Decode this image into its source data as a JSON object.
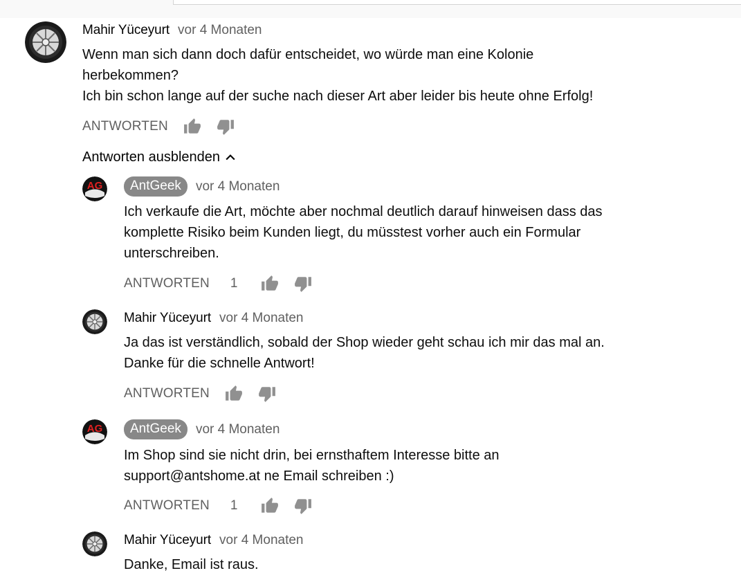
{
  "toggle_replies_label": "Antworten ausblenden",
  "reply_button_label": "ANTWORTEN",
  "comments": [
    {
      "author": "Mahir Yüceyurt",
      "time": "vor 4 Monaten",
      "text": "Wenn man sich dann doch dafür entscheidet, wo würde man eine Kolonie\nherbekommen?\nIch bin schon lange auf der suche nach dieser Art aber leider bis heute ohne Erfolg!",
      "likes": ""
    },
    {
      "author": "AntGeek",
      "time": "vor 4 Monaten",
      "text": "Ich verkaufe die Art, möchte aber nochmal deutlich darauf hinweisen dass das\nkomplette Risiko beim Kunden liegt, du müsstest vorher auch ein Formular\nunterschreiben.",
      "likes": "1"
    },
    {
      "author": "Mahir Yüceyurt",
      "time": "vor 4 Monaten",
      "text": "Ja das ist verständlich, sobald der Shop wieder geht schau ich mir das mal an.\nDanke für die schnelle Antwort!",
      "likes": ""
    },
    {
      "author": "AntGeek",
      "time": "vor 4 Monaten",
      "text": "Im Shop sind sie nicht drin, bei ernsthaftem Interesse bitte an\nsupport@antshome.at ne Email schreiben :)",
      "likes": "1"
    },
    {
      "author": "Mahir Yüceyurt",
      "time": "vor 4 Monaten",
      "text": "Danke, Email ist raus.",
      "likes": ""
    }
  ],
  "avatars": {
    "Mahir Yüceyurt": "tire-wheel-avatar",
    "AntGeek": "ag-logo-avatar"
  },
  "avatar_logo_text": "AG",
  "colors": {
    "badge_bg": "#888888",
    "muted": "#606060",
    "icon": "#909090",
    "ag_red": "#e02020"
  }
}
